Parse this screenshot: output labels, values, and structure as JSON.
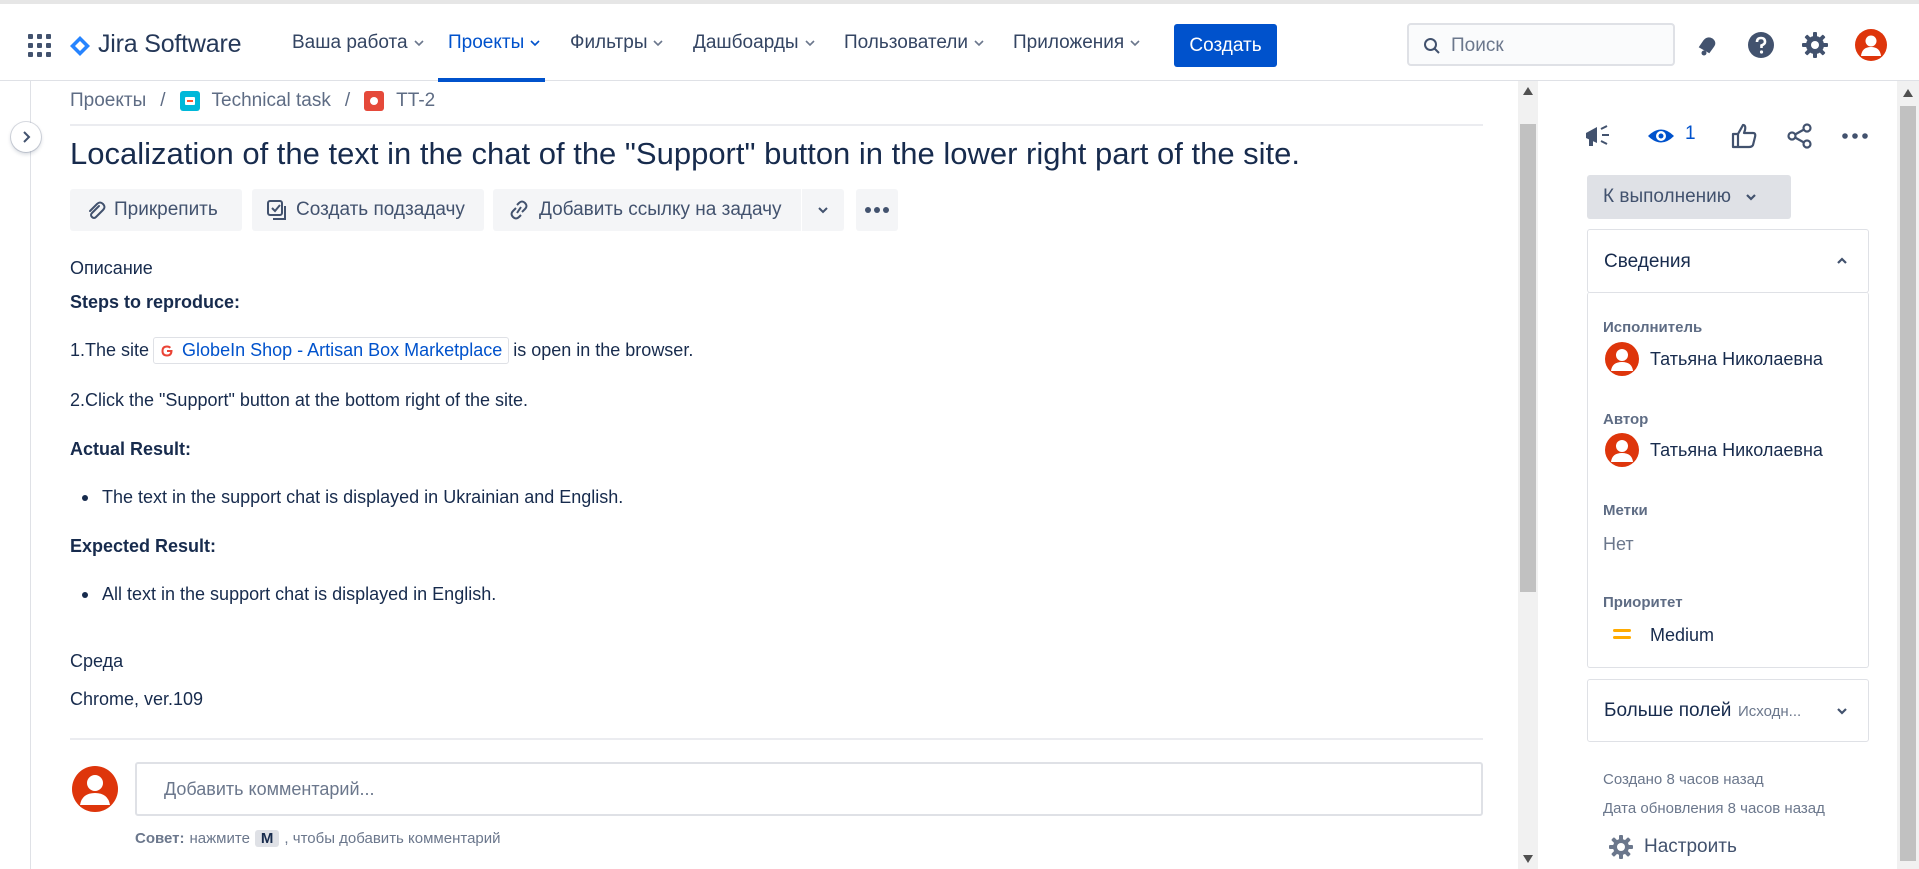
{
  "header": {
    "product_name": "Jira Software",
    "nav": [
      {
        "label": "Ваша работа"
      },
      {
        "label": "Проекты"
      },
      {
        "label": "Фильтры"
      },
      {
        "label": "Дашбоарды"
      },
      {
        "label": "Пользователи"
      },
      {
        "label": "Приложения"
      }
    ],
    "active_nav": "Проекты",
    "create_label": "Создать",
    "search_placeholder": "Поиск"
  },
  "breadcrumb": {
    "items": [
      "Проекты",
      "Technical task",
      "TT-2"
    ],
    "separator": "/"
  },
  "issue": {
    "title": "Localization of the text in the chat of the \"Support\" button in the lower right part of the site.",
    "actions": {
      "attach": "Прикрепить",
      "subtask": "Создать подзадачу",
      "link": "Добавить ссылку на задачу"
    },
    "description_heading": "Описание",
    "steps_heading": "Steps to reproduce:",
    "step1_prefix": "1.The site",
    "step1_link": "GlobeIn Shop - Artisan Box Marketplace",
    "step1_suffix": "is open in the browser.",
    "step2": "2.Click the \"Support\" button at the bottom right of the site.",
    "actual_heading": "Actual Result:",
    "actual_item": "The text in the support chat is displayed in Ukrainian and English.",
    "expected_heading": "Expected Result:",
    "expected_item": "All text in the support chat is displayed in English.",
    "environment_heading": "Среда",
    "environment_value": "Chrome, ver.109"
  },
  "comment": {
    "placeholder": "Добавить комментарий...",
    "tip_bold": "Совет:",
    "tip_pre": "нажмите",
    "tip_key": "M",
    "tip_post": ", чтобы добавить комментарий"
  },
  "sidebar": {
    "watch_count": "1",
    "status": "К выполнению",
    "details_heading": "Сведения",
    "assignee_label": "Исполнитель",
    "assignee_name": "Татьяна Николаевна",
    "reporter_label": "Автор",
    "reporter_name": "Татьяна Николаевна",
    "labels_label": "Метки",
    "labels_value": "Нет",
    "priority_label": "Приоритет",
    "priority_value": "Medium",
    "more_fields": "Больше полей",
    "more_fields_hint": "Исходн...",
    "created": "Создано 8 часов назад",
    "updated": "Дата обновления 8 часов назад",
    "configure": "Настроить"
  },
  "colors": {
    "brand": "#0052cc",
    "avatar": "#de350b",
    "priority_medium": "#ffab00"
  },
  "icons": [
    "apps-grid-icon",
    "jira-logo-icon",
    "chevron-down-icon",
    "search-icon",
    "notification-icon",
    "help-icon",
    "settings-icon",
    "user-avatar-icon",
    "attachment-icon",
    "subtask-icon",
    "link-icon",
    "more-icon",
    "feedback-icon",
    "watch-icon",
    "like-icon",
    "share-icon",
    "chevron-up-icon",
    "gear-icon",
    "google-icon"
  ]
}
